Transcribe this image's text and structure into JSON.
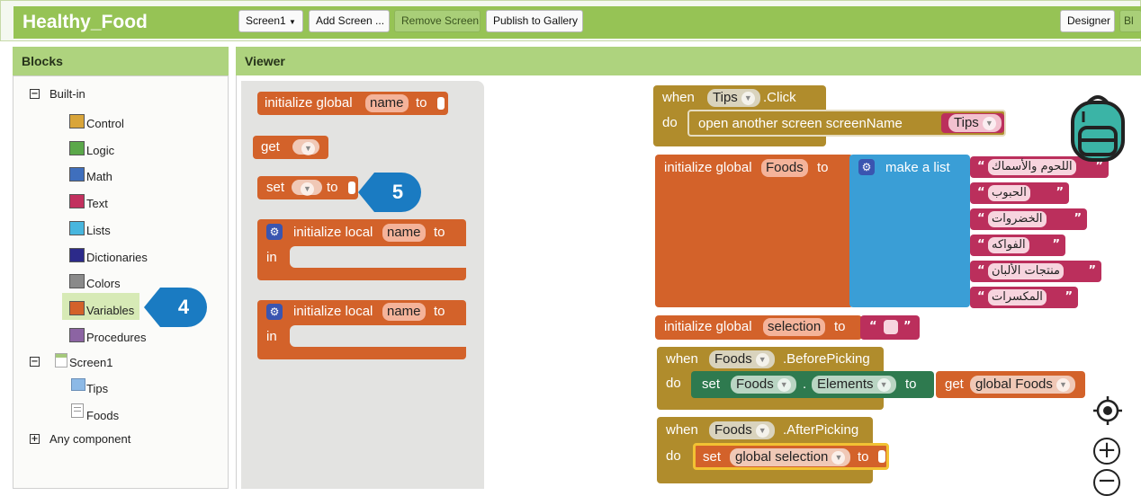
{
  "app": {
    "title": "Healthy_Food"
  },
  "toolbar": {
    "screen_select": "Screen1",
    "add_screen": "Add Screen ...",
    "remove_screen": "Remove Screen",
    "publish": "Publish to Gallery",
    "designer": "Designer",
    "blocks_partial": "Bl"
  },
  "blocks_panel": {
    "title": "Blocks",
    "builtin_label": "Built-in",
    "builtin_items": [
      {
        "label": "Control",
        "color": "#d9a53a"
      },
      {
        "label": "Logic",
        "color": "#5ba84a"
      },
      {
        "label": "Math",
        "color": "#3f6fbd"
      },
      {
        "label": "Text",
        "color": "#c2305e"
      },
      {
        "label": "Lists",
        "color": "#48b6de"
      },
      {
        "label": "Dictionaries",
        "color": "#2c2a8a"
      },
      {
        "label": "Colors",
        "color": "#8a8a8a"
      },
      {
        "label": "Variables",
        "color": "#d3622a"
      },
      {
        "label": "Procedures",
        "color": "#8c64a3"
      }
    ],
    "screen_label": "Screen1",
    "screen_children": [
      "Tips",
      "Foods"
    ],
    "any_component": "Any component"
  },
  "viewer": {
    "title": "Viewer",
    "flyout": {
      "init_global": {
        "prefix": "initialize global",
        "name": "name",
        "suffix": "to"
      },
      "get": {
        "label": "get"
      },
      "set": {
        "label": "set",
        "suffix": "to"
      },
      "init_local_1": {
        "prefix": "initialize local",
        "name": "name",
        "suffix": "to",
        "in": "in"
      },
      "init_local_2": {
        "prefix": "initialize local",
        "name": "name",
        "suffix": "to",
        "in": "in"
      }
    },
    "workspace": {
      "tips_click": {
        "when": "when",
        "component": "Tips",
        "event": ".Click",
        "do": "do",
        "call": "open another screen  screenName",
        "value": "Tips"
      },
      "foods_list": {
        "prefix": "initialize global",
        "name": "Foods",
        "suffix": "to",
        "make_list": "make a list",
        "items": [
          "اللحوم والأسماك",
          "الحبوب",
          "الخضروات",
          "الفواكه",
          "منتجات الألبان",
          "المكسرات"
        ]
      },
      "selection": {
        "prefix": "initialize global",
        "name": "selection",
        "suffix": "to"
      },
      "before_picking": {
        "when": "when",
        "component": "Foods",
        "event": ".BeforePicking",
        "do": "do",
        "set": "set",
        "set_component": "Foods",
        "dot": ".",
        "property": "Elements",
        "to": "to",
        "get": "get",
        "get_var": "global Foods"
      },
      "after_picking": {
        "when": "when",
        "component": "Foods",
        "event": ".AfterPicking",
        "do": "do",
        "set": "set",
        "set_var": "global selection",
        "to": "to"
      }
    }
  },
  "callouts": {
    "step4": "4",
    "step5": "5"
  },
  "icons": {
    "collapse": "minus-box-icon",
    "expand": "plus-box-icon",
    "target": "crosshair-icon",
    "zoom_in": "zoom-in-icon",
    "zoom_out": "zoom-out-icon",
    "backpack": "backpack-icon"
  }
}
